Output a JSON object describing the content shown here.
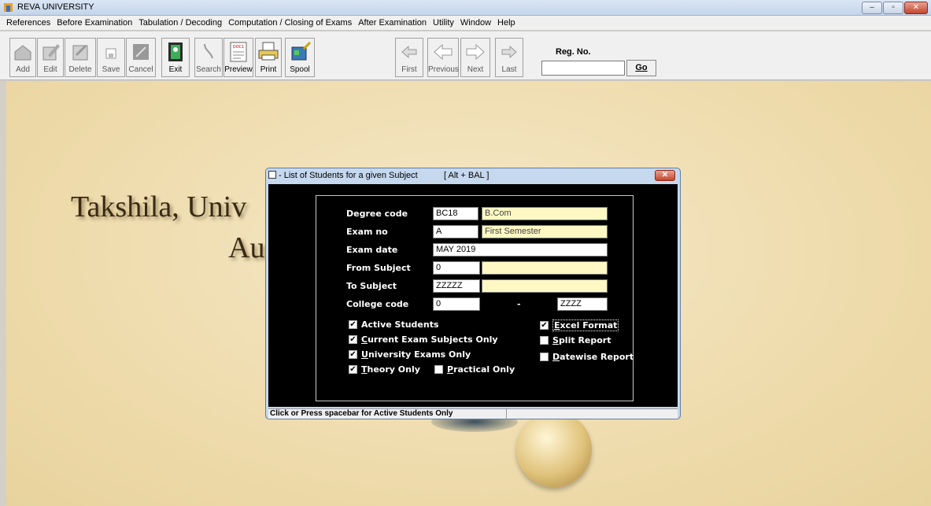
{
  "window": {
    "title": "REVA UNIVERSITY",
    "controls": [
      "–",
      "▫",
      "✕"
    ]
  },
  "menu": [
    "References",
    "Before Examination",
    "Tabulation / Decoding",
    "Computation / Closing of Exams",
    "After Examination",
    "Utility",
    "Window",
    "Help"
  ],
  "toolbar": {
    "buttons": [
      {
        "label": "Add"
      },
      {
        "label": "Edit"
      },
      {
        "label": "Delete"
      },
      {
        "label": "Save"
      },
      {
        "label": "Cancel"
      },
      {
        "label": "Exit"
      },
      {
        "label": "Search"
      },
      {
        "label": "Preview"
      },
      {
        "label": "Print"
      },
      {
        "label": "Spool"
      },
      {
        "label": "First"
      },
      {
        "label": "Previous"
      },
      {
        "label": "Next"
      },
      {
        "label": "Last"
      }
    ],
    "reg_label": "Reg. No.",
    "reg_value": "",
    "go_label": "Go",
    "preview_icon_text": "DOC1"
  },
  "background": {
    "line1": "Takshila, Univ",
    "line2": "Au"
  },
  "dialog": {
    "title": "- List of Students for a given Subject",
    "hotkey": "[ Alt + BAL ]",
    "fields": {
      "degree_label": "Degree code",
      "degree_code": "BC18",
      "degree_desc": "B.Com",
      "examno_label": "Exam no",
      "exam_no": "A",
      "exam_desc": "First Semester",
      "examdate_label": "Exam date",
      "exam_date": "MAY 2019",
      "fromsub_label": "From Subject",
      "from_subject": "0",
      "from_desc": "",
      "tosub_label": "To Subject",
      "to_subject": "ZZZZZ",
      "to_desc": "",
      "college_label": "College code",
      "college_from": "0",
      "college_sep": "-",
      "college_to": "ZZZZ"
    },
    "checks": {
      "active": {
        "label": "Active Students",
        "checked": true
      },
      "current": {
        "label_u": "C",
        "label_rest": "urrent Exam Subjects Only",
        "checked": true
      },
      "university": {
        "label_u": "U",
        "label_rest": "niversity Exams Only",
        "checked": true
      },
      "theory": {
        "label_u": "T",
        "label_rest": "heory Only",
        "checked": true
      },
      "practical": {
        "label_u": "P",
        "label_rest": "ractical Only",
        "checked": false
      },
      "excel": {
        "label_u": "E",
        "label_rest": "xcel Format",
        "checked": true
      },
      "split": {
        "label_u": "S",
        "label_rest": "plit Report",
        "checked": false
      },
      "datewise": {
        "label_u": "D",
        "label_rest": "atewise Report",
        "checked": false
      }
    },
    "status": "Click or Press spacebar for Active Students Only"
  }
}
